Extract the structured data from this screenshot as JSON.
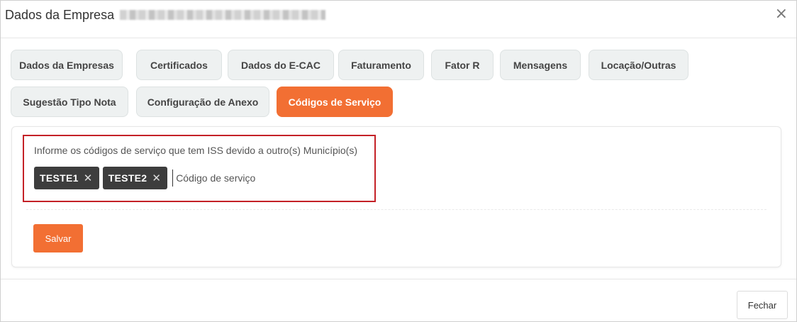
{
  "modal": {
    "title": "Dados da Empresa",
    "close_icon": "close-icon"
  },
  "tabs": [
    {
      "label": "Dados da Empresas",
      "active": false
    },
    {
      "label": "Certificados",
      "active": false
    },
    {
      "label": "Dados do E-CAC",
      "active": false
    },
    {
      "label": "Faturamento",
      "active": false
    },
    {
      "label": "Fator R",
      "active": false
    },
    {
      "label": "Mensagens",
      "active": false
    },
    {
      "label": "Locação/Outras",
      "active": false
    },
    {
      "label": "Sugestão Tipo Nota",
      "active": false
    },
    {
      "label": "Configuração de Anexo",
      "active": false
    },
    {
      "label": "Códigos de Serviço",
      "active": true
    }
  ],
  "form": {
    "label": "Informe os códigos de serviço que tem ISS devido a outro(s) Município(s)",
    "tags": [
      "TESTE1",
      "TESTE2"
    ],
    "input_placeholder": "Código de serviço",
    "input_value": "",
    "save_label": "Salvar"
  },
  "footer": {
    "close_label": "Fechar"
  },
  "colors": {
    "accent": "#f26f33",
    "tag_bg": "#3d3d3d",
    "highlight": "#c42127"
  }
}
